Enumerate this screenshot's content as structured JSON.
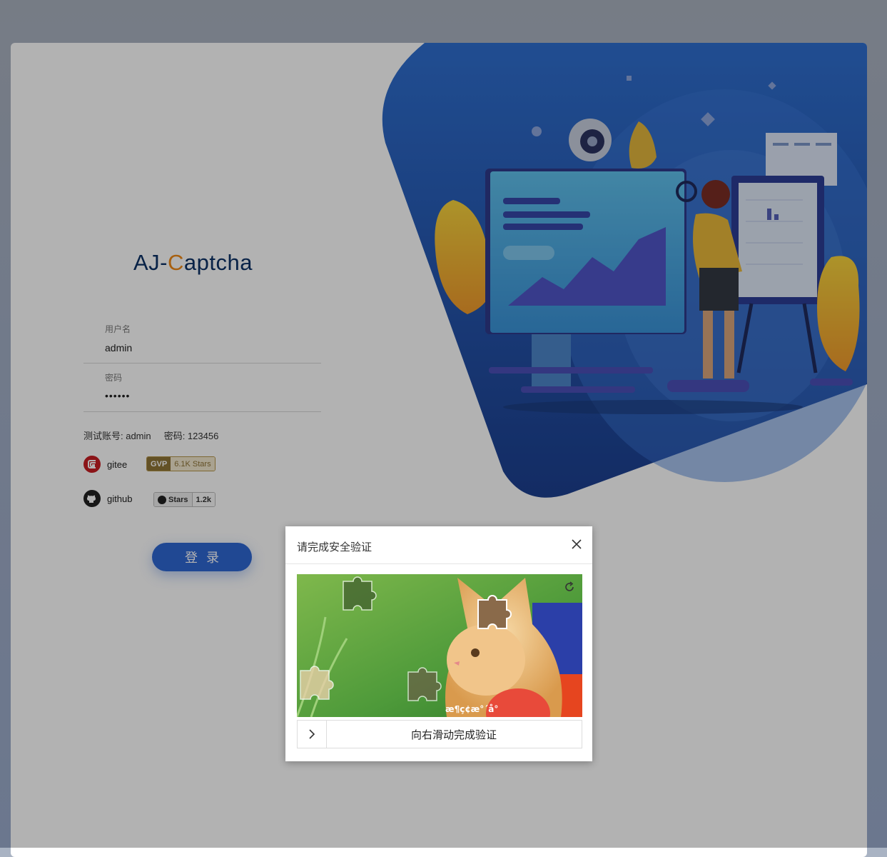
{
  "app": {
    "logo_prefix": "AJ-",
    "logo_accent": "C",
    "logo_suffix": "aptcha"
  },
  "form": {
    "username_label": "用户名",
    "username_value": "admin",
    "password_label": "密码",
    "password_value": "••••••",
    "hint": "测试账号: admin     密码: 123456"
  },
  "links": {
    "gitee_label": "gitee",
    "gvp_left": "GVP",
    "gvp_right": "6.1K Stars",
    "github_label": "github",
    "gh_left": "Stars",
    "gh_right": "1.2k"
  },
  "login_button": "登录",
  "captcha": {
    "title": "请完成安全验证",
    "slider_text": "向右滑动完成验证",
    "watermark": "æ¶ç¢æ°´å°"
  },
  "colors": {
    "brand": "#2f67d3",
    "accent": "#f08a18",
    "navy": "#0c3266"
  }
}
